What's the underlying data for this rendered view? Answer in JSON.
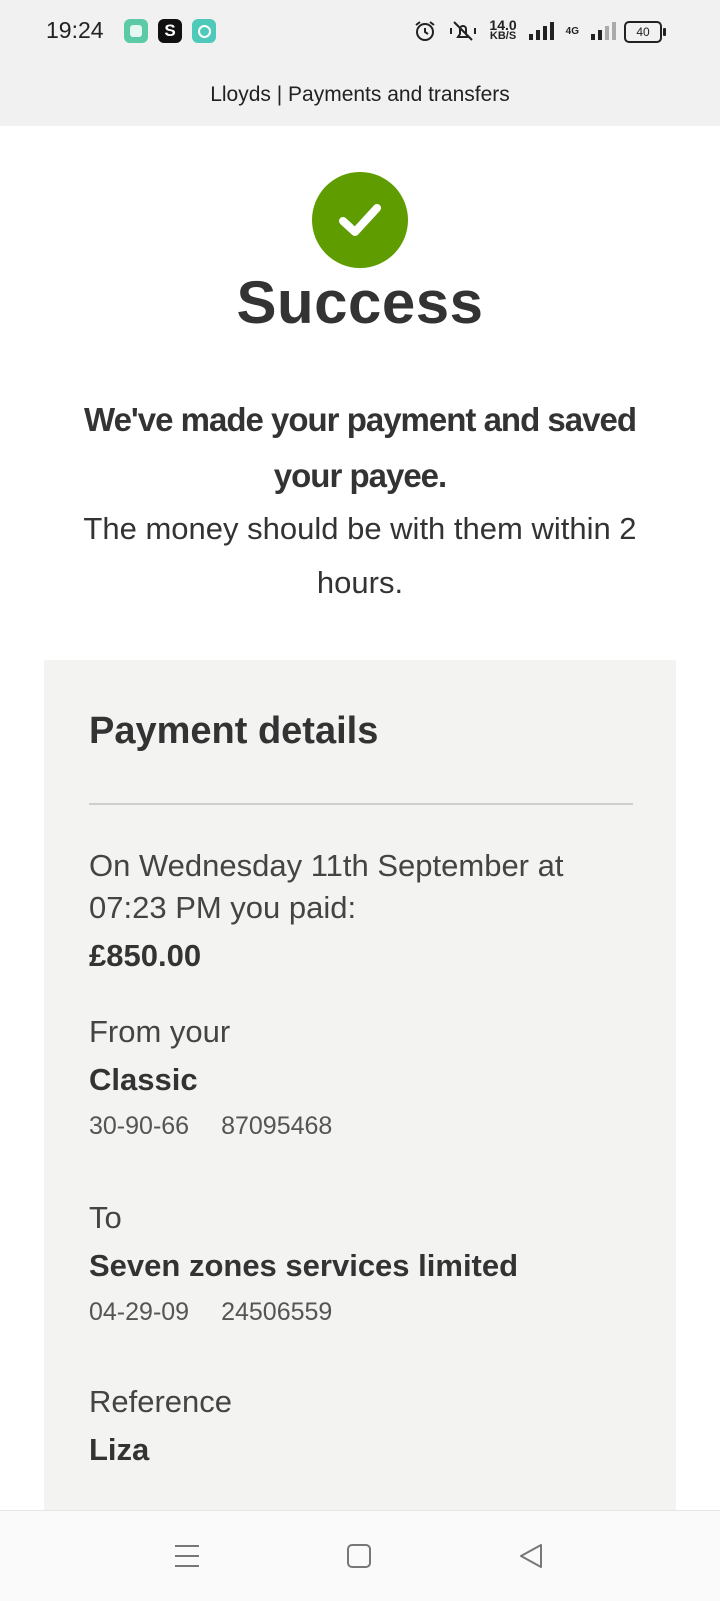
{
  "status_bar": {
    "time": "19:24",
    "network_speed": "14.0",
    "network_unit": "KB/S",
    "network_type": "4G",
    "battery": "40"
  },
  "app_bar": {
    "title": "Lloyds | Payments and transfers"
  },
  "success": {
    "title": "Success",
    "message_bold": "We've made your payment and saved your payee.",
    "message": "The money should be with them within 2 hours.",
    "icon_color": "#5e9c00"
  },
  "payment_details": {
    "heading": "Payment details",
    "paid_text": "On Wednesday 11th September at 07:23 PM you paid:",
    "amount": "£850.00",
    "from": {
      "label": "From your",
      "account_name": "Classic",
      "sort_code": "30-90-66",
      "account_number": "87095468"
    },
    "to": {
      "label": "To",
      "payee_name": "Seven zones services limited",
      "sort_code": "04-29-09",
      "account_number": "24506559"
    },
    "reference": {
      "label": "Reference",
      "value": "Liza"
    }
  },
  "nav_bar": {
    "icons": [
      "menu-icon",
      "home-square-icon",
      "back-triangle-icon"
    ]
  }
}
